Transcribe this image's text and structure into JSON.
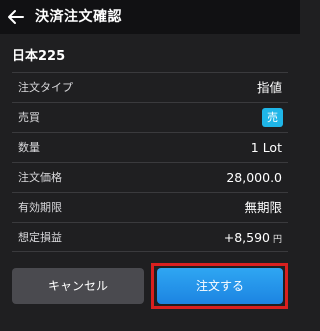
{
  "header": {
    "title": "決済注文確認",
    "back_icon": "arrow-left-icon"
  },
  "symbol": "日本225",
  "rows": [
    {
      "label": "注文タイプ",
      "value": "指値"
    },
    {
      "label": "売買",
      "value": "売",
      "badge_color": "#1fb6e8"
    },
    {
      "label": "数量",
      "value": "1 Lot"
    },
    {
      "label": "注文価格",
      "value": "28,000.0"
    },
    {
      "label": "有効期限",
      "value": "無期限"
    },
    {
      "label": "想定損益",
      "value": "+8,590",
      "unit": "円"
    }
  ],
  "buttons": {
    "cancel": "キャンセル",
    "order": "注文する"
  },
  "colors": {
    "background": "#1f1f21",
    "header": "#111113",
    "accent": "#1c84e2",
    "highlight": "#d9201f"
  }
}
